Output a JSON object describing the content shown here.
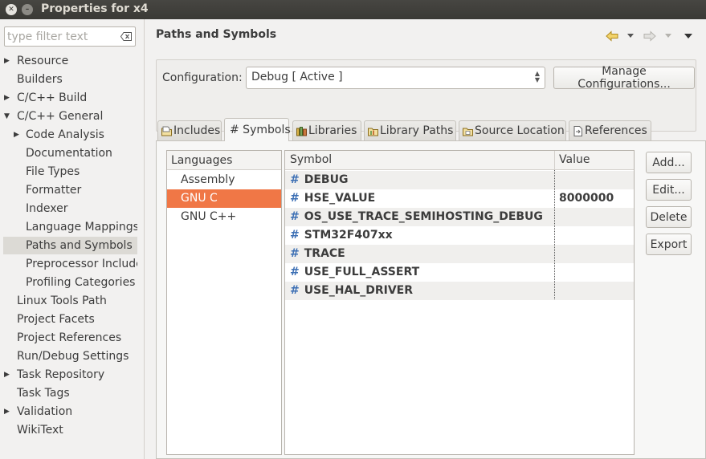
{
  "window": {
    "title": "Properties for x4"
  },
  "filter": {
    "placeholder": "type filter text"
  },
  "tree": [
    {
      "label": "Resource",
      "expandable": true
    },
    {
      "label": "Builders",
      "expandable": false
    },
    {
      "label": "C/C++ Build",
      "expandable": true
    },
    {
      "label": "C/C++ General",
      "expandable": true,
      "expanded": true
    },
    {
      "label": "Code Analysis",
      "expandable": true
    },
    {
      "label": "Documentation",
      "expandable": false
    },
    {
      "label": "File Types",
      "expandable": false
    },
    {
      "label": "Formatter",
      "expandable": false
    },
    {
      "label": "Indexer",
      "expandable": false
    },
    {
      "label": "Language Mappings",
      "expandable": false
    },
    {
      "label": "Paths and Symbols",
      "expandable": false,
      "selected": true
    },
    {
      "label": "Preprocessor Include",
      "expandable": false
    },
    {
      "label": "Profiling Categories",
      "expandable": false
    },
    {
      "label": "Linux Tools Path",
      "expandable": false
    },
    {
      "label": "Project Facets",
      "expandable": false
    },
    {
      "label": "Project References",
      "expandable": false
    },
    {
      "label": "Run/Debug Settings",
      "expandable": false
    },
    {
      "label": "Task Repository",
      "expandable": true
    },
    {
      "label": "Task Tags",
      "expandable": false
    },
    {
      "label": "Validation",
      "expandable": true
    },
    {
      "label": "WikiText",
      "expandable": false
    }
  ],
  "page": {
    "title": "Paths and Symbols"
  },
  "config": {
    "label": "Configuration:",
    "value": "Debug  [ Active ]",
    "manage_label": "Manage Configurations..."
  },
  "tabs": [
    {
      "label": "Includes",
      "icon": "includes-icon"
    },
    {
      "label": "# Symbols",
      "icon": "",
      "active": true
    },
    {
      "label": "Libraries",
      "icon": "libraries-icon"
    },
    {
      "label": "Library Paths",
      "icon": "library-paths-icon"
    },
    {
      "label": "Source Location",
      "icon": "source-folder-icon"
    },
    {
      "label": "References",
      "icon": "references-icon"
    }
  ],
  "languages": {
    "header": "Languages",
    "items": [
      {
        "label": "Assembly"
      },
      {
        "label": "GNU C",
        "selected": true
      },
      {
        "label": "GNU C++"
      }
    ]
  },
  "symbols": {
    "header_symbol": "Symbol",
    "header_value": "Value",
    "hash": "#",
    "rows": [
      {
        "name": "DEBUG",
        "value": ""
      },
      {
        "name": "HSE_VALUE",
        "value": "8000000"
      },
      {
        "name": "OS_USE_TRACE_SEMIHOSTING_DEBUG",
        "value": ""
      },
      {
        "name": "STM32F407xx",
        "value": ""
      },
      {
        "name": "TRACE",
        "value": ""
      },
      {
        "name": "USE_FULL_ASSERT",
        "value": ""
      },
      {
        "name": "USE_HAL_DRIVER",
        "value": ""
      }
    ]
  },
  "buttons": {
    "add": "Add...",
    "edit": "Edit...",
    "delete": "Delete",
    "export": "Export"
  },
  "colors": {
    "selection": "#f07746",
    "titlebar": "#3c3b37",
    "hash": "#3c6fb4"
  }
}
